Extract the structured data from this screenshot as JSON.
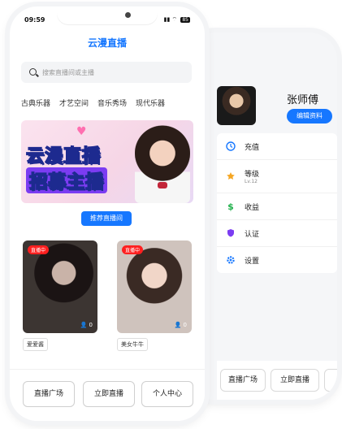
{
  "front": {
    "status": {
      "time": "09:59",
      "signal": "▮▮ ⌔",
      "battery": "85"
    },
    "title": "云漫直播",
    "search": {
      "placeholder": "搜索直播间或主播"
    },
    "categories": [
      "古典乐器",
      "才艺空间",
      "音乐秀场",
      "现代乐器"
    ],
    "banner": {
      "line1": "云漫直播",
      "line2": "招募主播"
    },
    "recommend_button": "推荐直播间",
    "rooms": [
      {
        "tag": "直播中",
        "viewers": "0",
        "name": "爱爱酱"
      },
      {
        "tag": "直播中",
        "viewers": "0",
        "name": "美女牛牛"
      }
    ],
    "nav": [
      "直播广场",
      "立即直播",
      "个人中心"
    ]
  },
  "back": {
    "profile": {
      "name": "张师傅",
      "edit": "编辑资料"
    },
    "menu": [
      {
        "label": "充值",
        "icon": "clock-icon"
      },
      {
        "label": "等级",
        "sub": "Lv.12",
        "icon": "level-icon"
      },
      {
        "label": "收益",
        "icon": "dollar-icon"
      },
      {
        "label": "认证",
        "icon": "shield-icon"
      },
      {
        "label": "设置",
        "icon": "gear-icon"
      }
    ],
    "nav": [
      "直播广场",
      "立即直播"
    ]
  },
  "colors": {
    "accent": "#1677ff",
    "live": "#ff1f1f",
    "banner_text": "#1d2a8f"
  }
}
